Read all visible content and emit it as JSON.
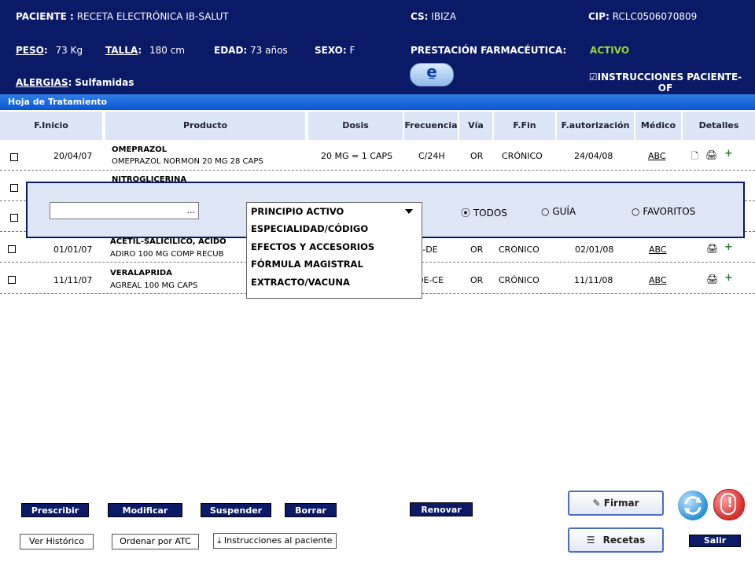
{
  "header": {
    "paciente_label": "PACIENTE :",
    "paciente_value": "RECETA ELECTRÓNICA IB-SALUT",
    "cs_label": "CS:",
    "cs_value": "IBIZA",
    "cip_label": "CIP:",
    "cip_value": "RCLC0506070809",
    "peso_label": "PESO",
    "peso_value": "73 Kg",
    "talla_label": "TALLA",
    "talla_value": "180 cm",
    "edad_label": "EDAD",
    "edad_value": "73 años",
    "sexo_label": "SEXO:",
    "sexo_value": "F",
    "prestacion_label": "PRESTACIÓN FARMACÉUTICA:",
    "prestacion_value": "ACTIVO",
    "alergias_label": "ALERGIAS",
    "alergias_value": "Sulfamidas",
    "e_badge": "e",
    "instrucciones_checkbox": "☑",
    "instrucciones_label": "INSTRUCCIONES PACIENTE-OF"
  },
  "section_title": "Hoja de Tratamiento",
  "table": {
    "columns": [
      "F.Inicio",
      "Producto",
      "Dosis",
      "Frecuencia",
      "Vía",
      "F.Fin",
      "F.autorización",
      "Médico",
      "Detalles"
    ],
    "rows": [
      {
        "f_inicio": "20/04/07",
        "nombre": "OMEPRAZOL",
        "descripcion": "OMEPRAZOL NORMON 20 MG 28 CAPS",
        "dosis": "20 MG = 1 CAPS",
        "frecuencia": "C/24H",
        "via": "OR",
        "f_fin": "CRÓNICO",
        "f_autorizacion": "24/04/08",
        "medico": "ABC"
      },
      {
        "f_inicio": "",
        "nombre": "NITROGLICERINA",
        "descripcion": "",
        "dosis": "",
        "frecuencia": "",
        "via": "",
        "f_fin": "",
        "f_autorizacion": "",
        "medico": ""
      },
      {
        "f_inicio": "",
        "nombre": "",
        "descripcion": "",
        "dosis": "",
        "frecuencia": "",
        "via": "",
        "f_fin": "",
        "f_autorizacion": "",
        "medico": ""
      },
      {
        "f_inicio": "01/01/07",
        "nombre": "ACETIL-SALICILICO, ACIDO",
        "descripcion": "ADIRO 100 MG COMP RECUB",
        "dosis": "",
        "frecuencia": "A-DE",
        "via": "OR",
        "f_fin": "CRÓNICO",
        "f_autorizacion": "02/01/08",
        "medico": "ABC"
      },
      {
        "f_inicio": "11/11/07",
        "nombre": "VERALAPRIDA",
        "descripcion": "AGREAL 100 MG CAPS",
        "dosis": "",
        "frecuencia": "DE-CE",
        "via": "OR",
        "f_fin": "CRÓNICO",
        "f_autorizacion": "11/11/08",
        "medico": "ABC"
      }
    ]
  },
  "search": {
    "input_value": "...",
    "selected_filter": "PRINCIPIO ACTIVO",
    "options": [
      "PRINCIPIO ACTIVO",
      "ESPECIALIDAD/CÓDIGO",
      "EFECTOS Y ACCESORIOS",
      "FÓRMULA MAGISTRAL",
      "EXTRACTO/VACUNA"
    ],
    "radio_todos": "TODOS",
    "radio_guia": "GUÍA",
    "radio_favoritos": "FAVORITOS",
    "radio_selected": "TODOS"
  },
  "buttons": {
    "prescribir": "Prescribir",
    "modificar": "Modificar",
    "suspender": "Suspender",
    "borrar": "Borrar",
    "renovar": "Renovar",
    "firmar": "Firmar",
    "recetas": "Recetas",
    "ver_historico": "Ver Histórico",
    "ordenar_atc": "Ordenar por ATC",
    "instrucciones_paciente": "Instrucciones al paciente",
    "salir": "Salir"
  },
  "colors": {
    "header_bg": "#0b1a66",
    "accent_active": "#9ad03a",
    "table_header_bg": "#dde6f6",
    "alert_red": "#d62d2d",
    "refresh_blue": "#2a8fd6"
  }
}
